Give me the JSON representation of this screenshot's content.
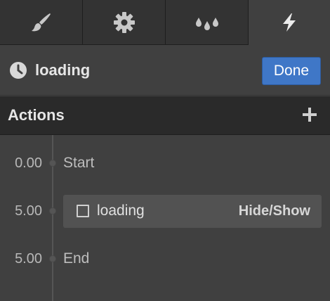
{
  "tabs": [
    {
      "icon": "paintbrush-icon",
      "active": false
    },
    {
      "icon": "gear-icon",
      "active": false
    },
    {
      "icon": "droplets-icon",
      "active": false
    },
    {
      "icon": "lightning-icon",
      "active": true
    }
  ],
  "header": {
    "icon": "clock-icon",
    "title": "loading",
    "done_label": "Done"
  },
  "actions": {
    "title": "Actions",
    "add_icon": "plus-icon"
  },
  "timeline": [
    {
      "time": "0.00",
      "label": "Start"
    },
    {
      "time": "5.00",
      "action_name": "loading",
      "action_type": "Hide/Show",
      "checkbox": "unchecked"
    },
    {
      "time": "5.00",
      "label": "End"
    }
  ],
  "colors": {
    "background": "#404040",
    "tabbar": "#2b2b2b",
    "accent_button": "#3f77c7",
    "card": "#525252"
  }
}
